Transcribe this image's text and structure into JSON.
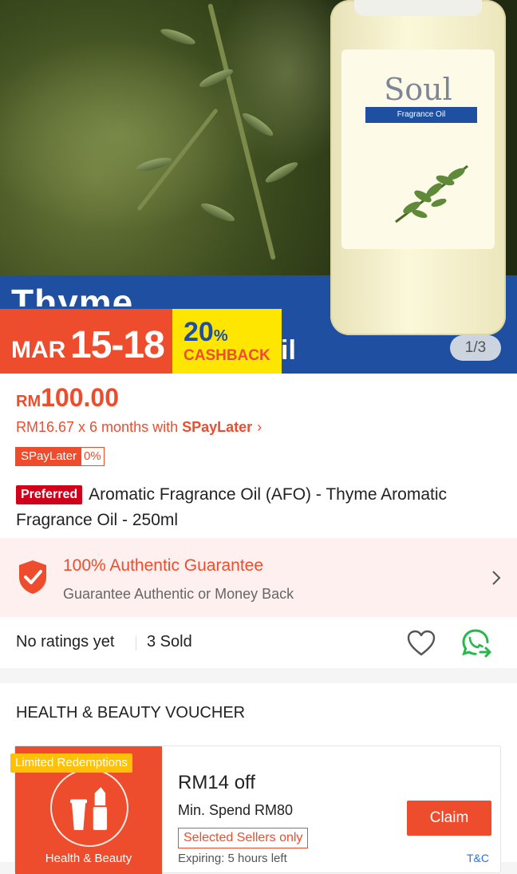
{
  "hero": {
    "brand": "Soul",
    "brand_sub": "Fragrance Oil",
    "product_word": "Thyme",
    "product_tail": "il",
    "promo_month": "MAR",
    "promo_dates": "15-18",
    "cashback_pct": "20",
    "cashback_pct_sign": "%",
    "cashback_label": "CASHBACK",
    "image_counter": "1/3"
  },
  "product": {
    "currency": "RM",
    "price": "100.00",
    "installment_prefix": "RM16.67 x 6 months with ",
    "installment_brand": "SPayLater",
    "installment_arrow": "›",
    "spaylater_badge": "SPayLater",
    "spaylater_rate": "0%",
    "preferred_badge": "Preferred",
    "title": "Aromatic Fragrance Oil (AFO) - Thyme Aromatic Fragrance Oil - 250ml"
  },
  "guarantee": {
    "title": "100% Authentic Guarantee",
    "subtitle": "Guarantee Authentic or Money Back"
  },
  "ratings": {
    "rating_text": "No ratings yet",
    "sold_text": "3 Sold"
  },
  "voucher": {
    "section_title": "HEALTH & BEAUTY VOUCHER",
    "limited_tag": "Limited Redemptions",
    "category": "Health & Beauty",
    "title": "RM14 off",
    "min_spend": "Min. Spend RM80",
    "seller_tag": "Selected Sellers only",
    "expiry": "Expiring: 5 hours left",
    "claim_label": "Claim",
    "tnc_label": "T&C"
  },
  "colors": {
    "accent": "#ee4d2d",
    "preferred": "#d0011b",
    "hero_blue": "#1e4fa0",
    "cashback_yellow": "#ffe600",
    "whatsapp_green": "#25b84a",
    "link_blue": "#2673dd"
  },
  "icons": [
    "shield-check-icon",
    "chevron-right-icon",
    "heart-icon",
    "whatsapp-share-icon",
    "lipstick-icon"
  ]
}
